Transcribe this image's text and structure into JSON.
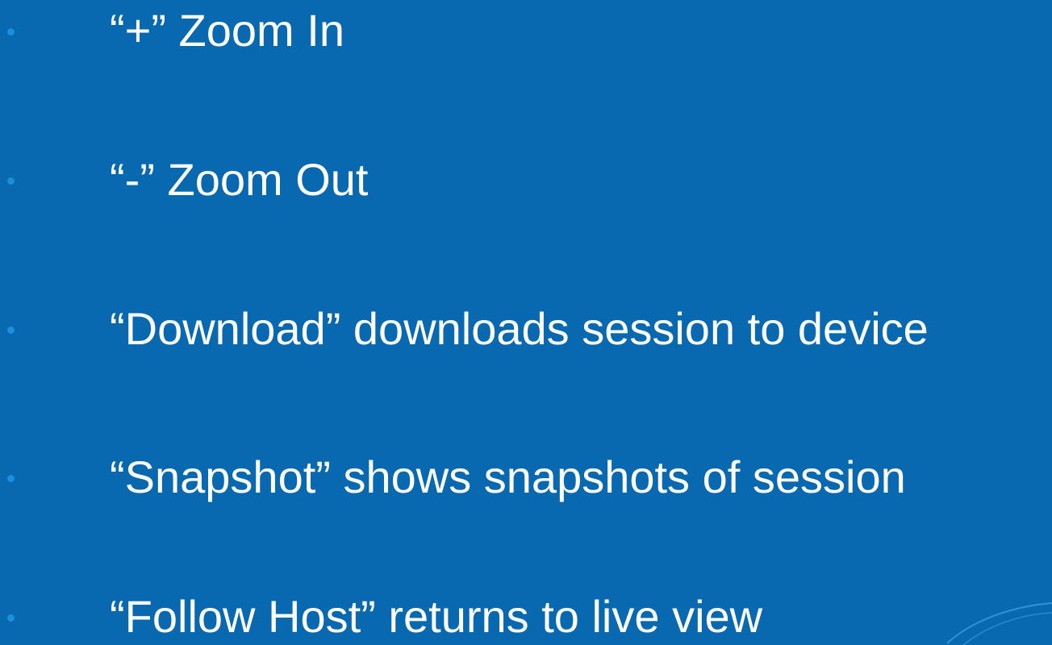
{
  "colors": {
    "background": "#0869b1",
    "text": "#ffffff",
    "bullet": "#1a8fe0",
    "swoosh": "#3d9ee3"
  },
  "bullets": [
    {
      "text": "“+”  Zoom In"
    },
    {
      "text": "“-”  Zoom Out"
    },
    {
      "text": "“Download” downloads session to device"
    },
    {
      "text": "“Snapshot” shows snapshots of session"
    },
    {
      "text": "“Follow Host” returns to live view"
    }
  ]
}
